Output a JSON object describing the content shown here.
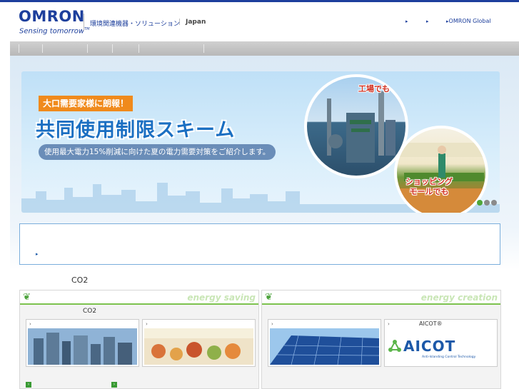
{
  "header": {
    "logo": "OMRON",
    "tagline": "Sensing tomorrow",
    "tagline_tm": "TM",
    "site_title": "環境関連機器・ソリューション",
    "site_separator": "|",
    "region": "Japan",
    "links": [
      {
        "label": ""
      },
      {
        "label": ""
      },
      {
        "label": "OMRON Global"
      }
    ]
  },
  "banner": {
    "tag": "大口需要家様に朗報！",
    "headline": "共同使用制限スキーム",
    "subline": "使用最大電力15%削減に向けた夏の電力需要対策をご紹介します。",
    "circle1_label": "工場でも",
    "circle2_label_line1": "ショッピング",
    "circle2_label_line2": "モールでも",
    "slide_index": 1,
    "slide_count": 3
  },
  "news": {
    "arrow": "▸"
  },
  "section": {
    "title": "CO2"
  },
  "panels": [
    {
      "title": "energy saving",
      "sub": "CO2",
      "cards": [
        {
          "label": ""
        },
        {
          "label": ""
        }
      ]
    },
    {
      "title": "energy creation",
      "sub": "",
      "cards": [
        {
          "label": ""
        },
        {
          "label": "AICOT®"
        }
      ]
    }
  ],
  "aicot": {
    "logo": "AICOT",
    "tagline": "Anti-Islanding Control Technology"
  },
  "colors": {
    "brand": "#1d3f9c",
    "accent_green": "#7cc24e",
    "headline_blue": "#1b6fc2",
    "tag_orange": "#f08a1c"
  }
}
